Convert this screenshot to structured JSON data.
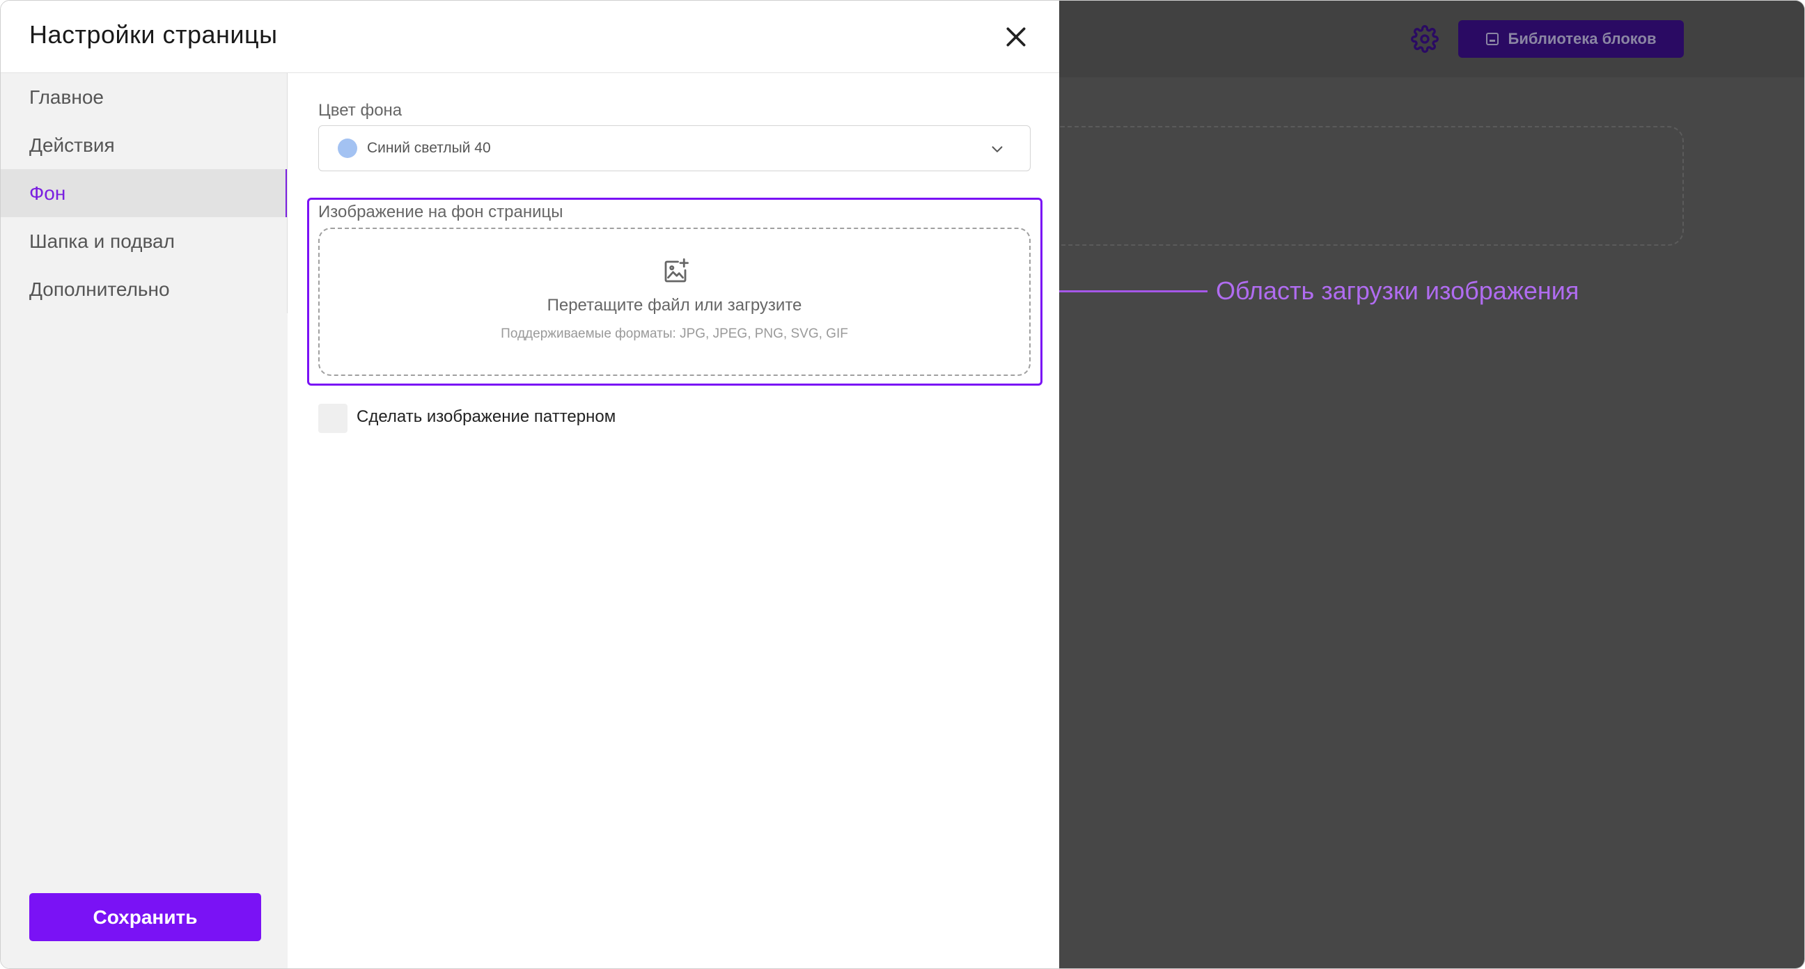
{
  "modal": {
    "title": "Настройки страницы",
    "close_icon": "close-icon"
  },
  "sidebar": {
    "items": [
      {
        "label": "Главное",
        "active": false
      },
      {
        "label": "Действия",
        "active": false
      },
      {
        "label": "Фон",
        "active": true
      },
      {
        "label": "Шапка и подвал",
        "active": false
      },
      {
        "label": "Дополнительно",
        "active": false
      }
    ],
    "save_label": "Сохранить"
  },
  "content": {
    "bg_color": {
      "label": "Цвет фона",
      "value": "Синий светлый 40",
      "swatch_color": "#a3c2f2"
    },
    "bg_image": {
      "label": "Изображение на фон страницы",
      "drop_title": "Перетащите файл или загрузите",
      "drop_formats": "Поддерживаемые форматы: JPG, JPEG, PNG, SVG, GIF"
    },
    "pattern_checkbox": {
      "label": "Сделать изображение паттерном",
      "checked": false
    }
  },
  "backdrop": {
    "library_label": "Библиотека блоков",
    "gear_icon": "gear-icon"
  },
  "annotation": {
    "text": "Область загрузки изображения"
  },
  "colors": {
    "accent": "#7a12f5",
    "annotation": "#b06cf0",
    "backdrop": "#474747"
  }
}
